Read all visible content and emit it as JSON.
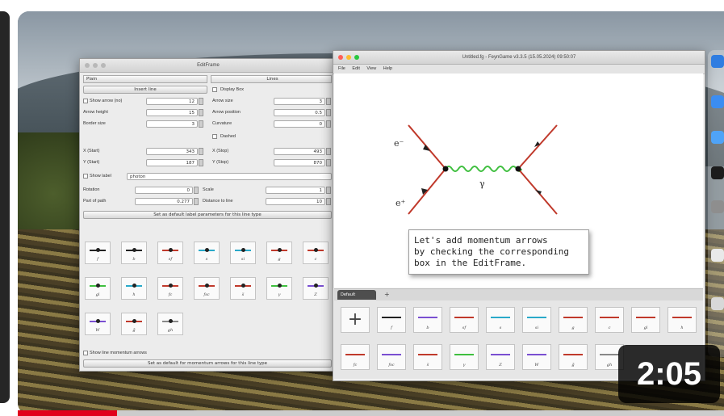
{
  "edit_frame": {
    "title": "EditFrame",
    "top_select_left": "Plain",
    "top_select_right": "Lines",
    "insert_button": "Insert line",
    "display_box_label": "Display Box",
    "rows_left": [
      {
        "label": "Show arrow (no)",
        "value": "12"
      },
      {
        "label": "Arrow height",
        "value": "15"
      },
      {
        "label": "Border size",
        "value": "3"
      }
    ],
    "rows_right": [
      {
        "label": "Arrow size",
        "value": "3"
      },
      {
        "label": "Arrow position",
        "value": "0.5"
      },
      {
        "label": "Curvature",
        "value": "0"
      }
    ],
    "dashes_label": "Dashed",
    "coords_left": [
      {
        "label": "X (Start)",
        "value": "343"
      },
      {
        "label": "Y (Start)",
        "value": "187"
      }
    ],
    "coords_right": [
      {
        "label": "X (Stop)",
        "value": "493"
      },
      {
        "label": "Y (Stop)",
        "value": "870"
      }
    ],
    "show_label": "Show label",
    "label_value": "photon",
    "rows_bottom": [
      {
        "label": "Rotation",
        "value": "0",
        "label2": "Scale",
        "value2": "1"
      },
      {
        "label": "Part of path",
        "value": "0.277",
        "label2": "Distance to line",
        "value2": "10"
      }
    ],
    "default_button": "Set as default label parameters for this line type",
    "tiles": [
      "f",
      "b",
      "sf",
      "s",
      "si",
      "g",
      "c",
      "gl",
      "h",
      "fc",
      "fsc",
      "s̅",
      "γ",
      "Z",
      "W",
      "g̃",
      "gh"
    ],
    "momentum_label": "Show line momentum arrows",
    "momentum_button": "Set as default for momentum arrows for this line type"
  },
  "feyngame": {
    "title": "Untitled.fg - FeynGame v3.3.5 (15.05.2024) 09:50:07",
    "menu": [
      "File",
      "Edit",
      "View",
      "Help"
    ],
    "diagram_labels": {
      "electron": "e⁻",
      "positron": "e⁺",
      "photon": "γ"
    },
    "tooltip": [
      "Let's add momentum arrows",
      "by checking the corresponding",
      "box in the EditFrame."
    ],
    "tab_label": "Default",
    "tab_add": "+",
    "palette_row1": [
      "+",
      "f",
      "b",
      "sf",
      "s",
      "si",
      "g",
      "c",
      "gl",
      "h"
    ],
    "palette_row2": [
      "fc",
      "fsc",
      "s̅",
      "γ",
      "Z",
      "W",
      "g̃",
      "gh"
    ]
  },
  "video": {
    "duration": "2:05",
    "progress": 0.14
  }
}
